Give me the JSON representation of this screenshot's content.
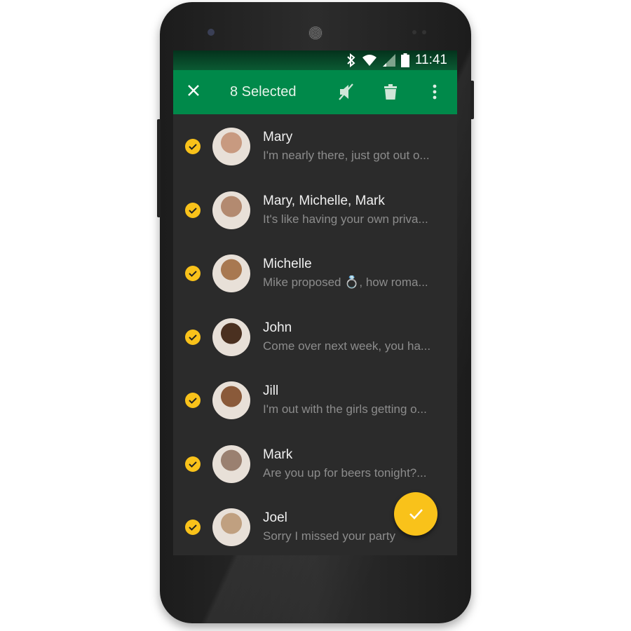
{
  "status_bar": {
    "time": "11:41",
    "icons": [
      "bluetooth-icon",
      "wifi-icon",
      "signal-icon",
      "battery-icon"
    ]
  },
  "toolbar": {
    "title": "8 Selected",
    "icons": [
      "close-icon",
      "mute-icon",
      "trash-icon",
      "more-vert-icon"
    ]
  },
  "colors": {
    "toolbar": "#00894a",
    "status_bar": "#0b4a2a",
    "accent": "#f9c21a",
    "list_bg": "#2b2b2b"
  },
  "conversations": [
    {
      "name": "Mary",
      "message": "I'm nearly there, just got out o...",
      "selected": true,
      "avatar": "#c89a80"
    },
    {
      "name": "Mary, Michelle, Mark",
      "message": "It's like having your own priva...",
      "selected": true,
      "avatar": "#b38a70"
    },
    {
      "name": "Michelle",
      "message": "Mike proposed 💍, how roma...",
      "selected": true,
      "avatar": "#a87850"
    },
    {
      "name": "John",
      "message": "Come over next week, you ha...",
      "selected": true,
      "avatar": "#4a3020"
    },
    {
      "name": "Jill",
      "message": "I'm out with the girls getting o...",
      "selected": true,
      "avatar": "#8a5a3a"
    },
    {
      "name": "Mark",
      "message": "Are you up for beers tonight?...",
      "selected": true,
      "avatar": "#9a8070"
    },
    {
      "name": "Joel",
      "message": "Sorry I missed your party",
      "selected": true,
      "avatar": "#c0a080"
    }
  ],
  "fab": {
    "icon": "check-icon"
  }
}
